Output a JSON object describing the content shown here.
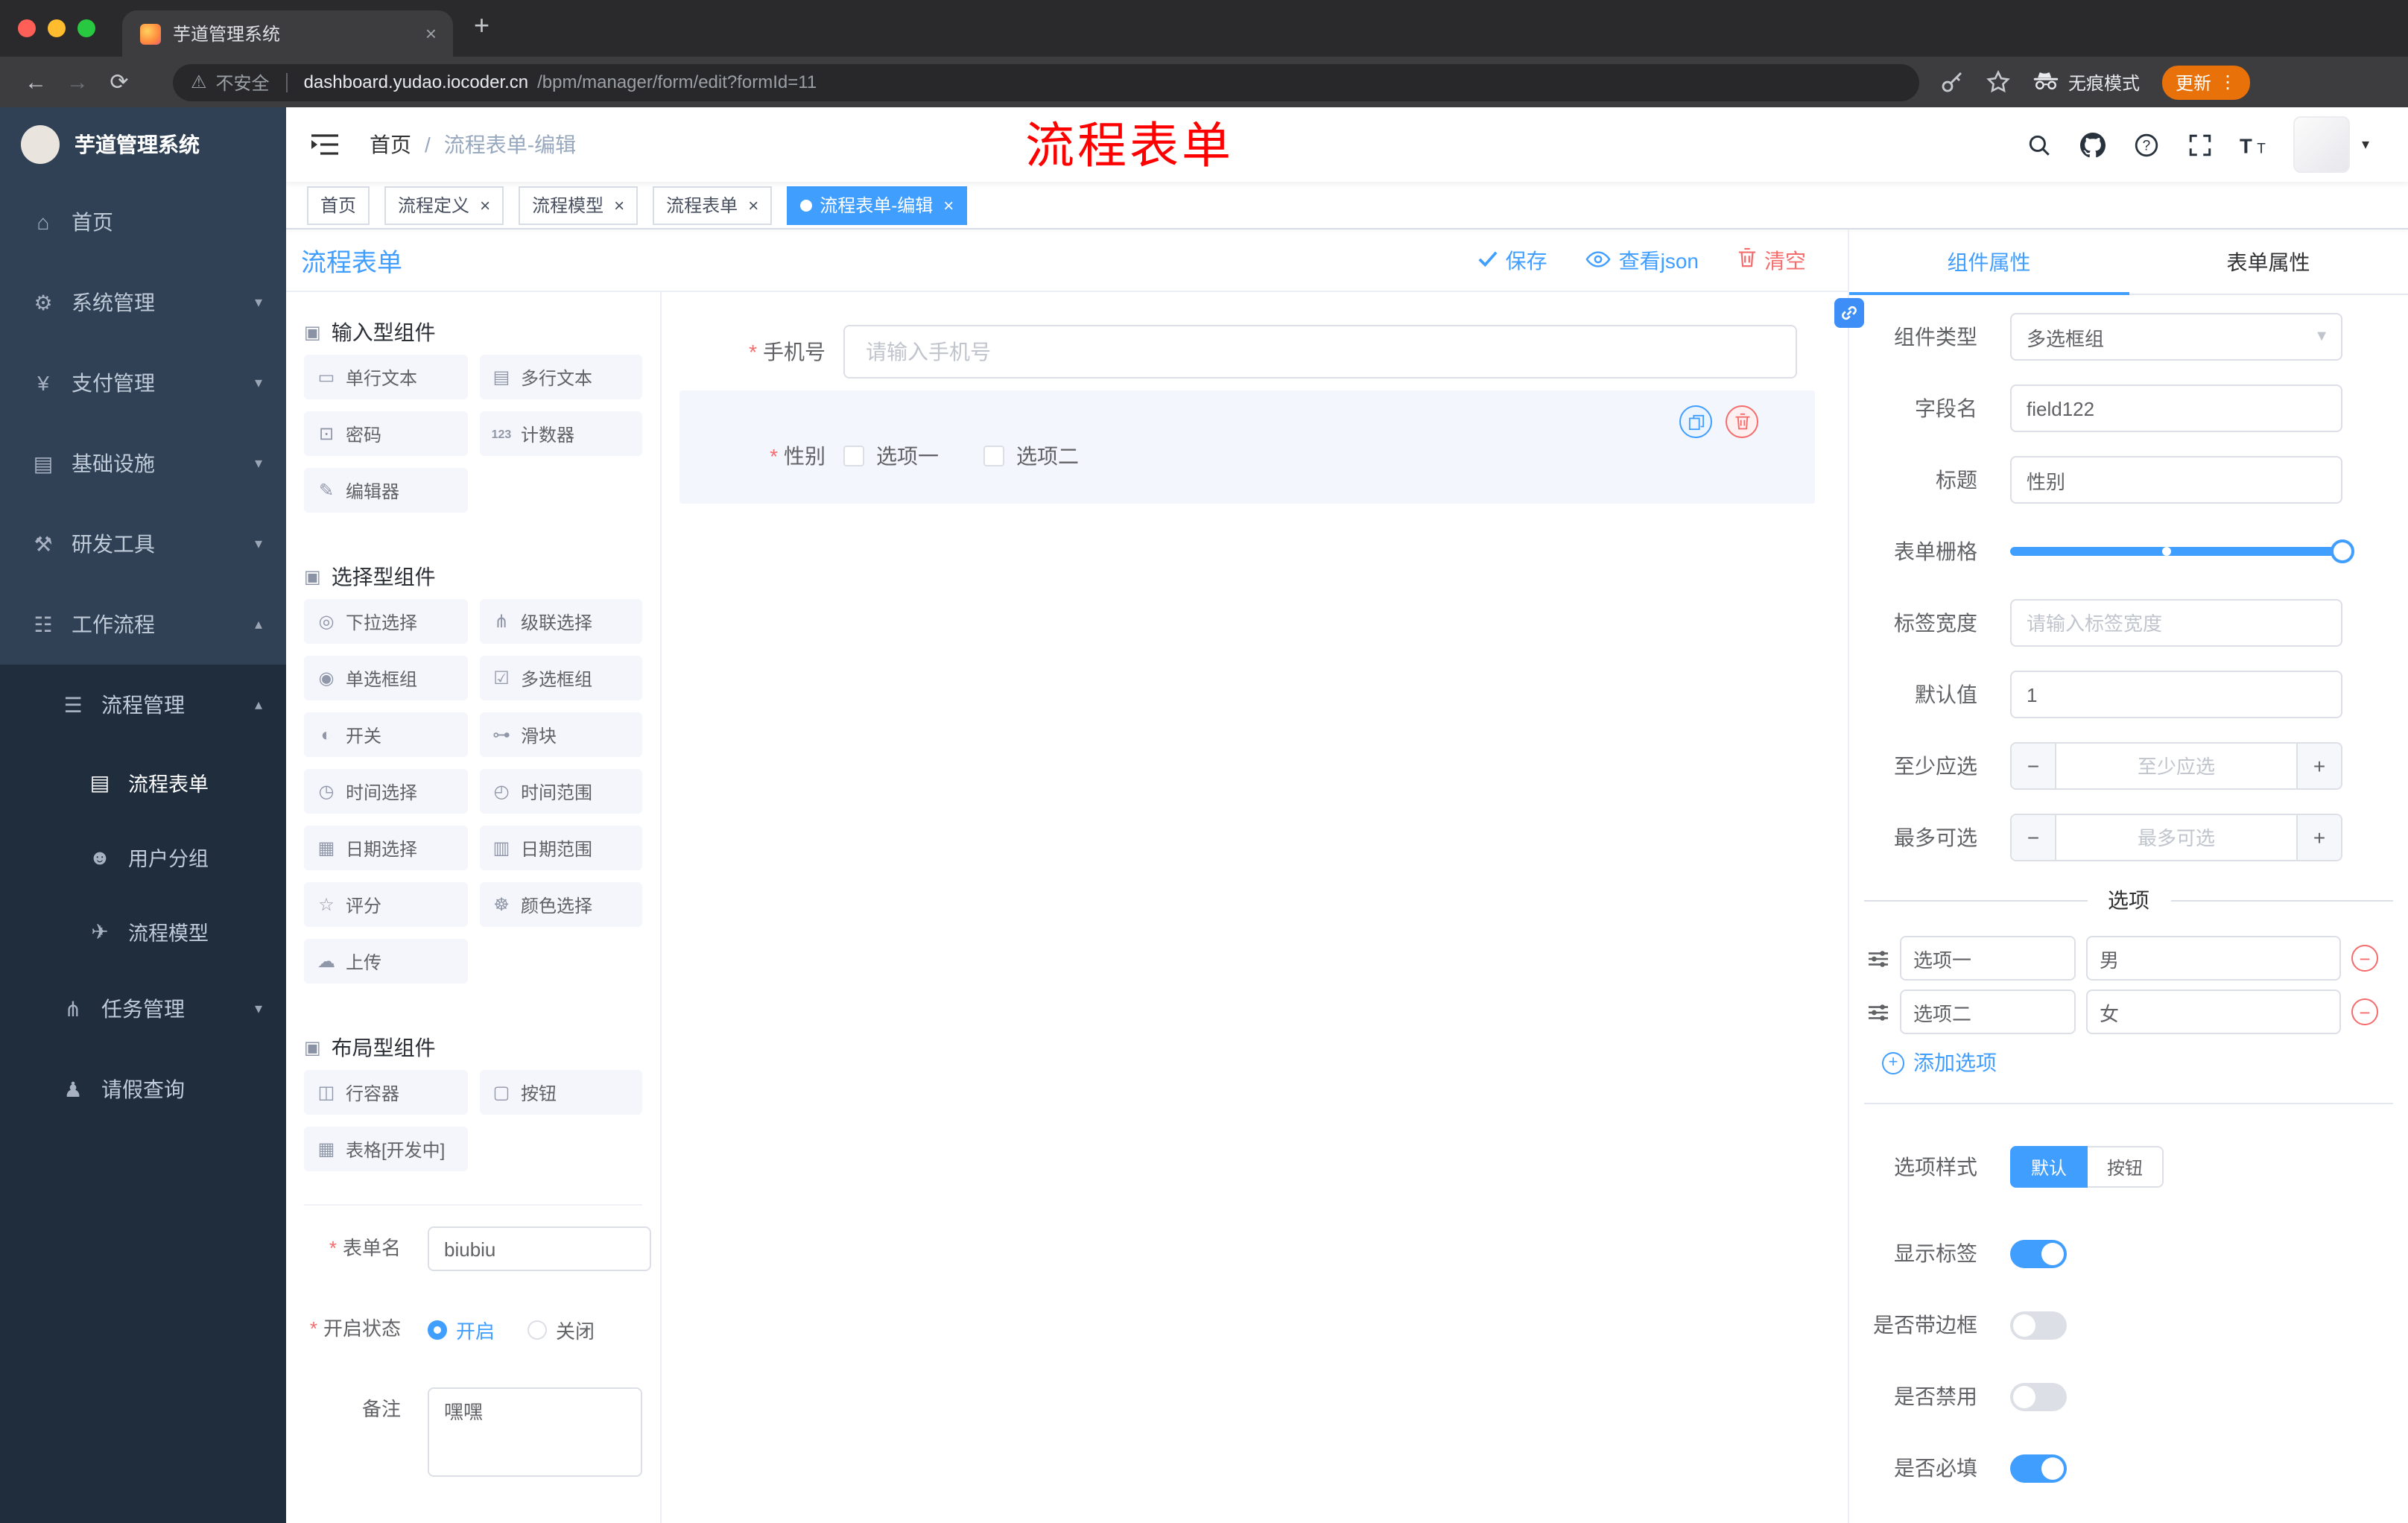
{
  "colors": {
    "accent": "#409eff",
    "danger": "#f56c6c",
    "annotation_red": "#ff0000",
    "sidebar_bg": "#304156",
    "sidebar_sub_bg": "#1f2d3d",
    "update_pill": "#e8710a"
  },
  "browser": {
    "tab_title": "芋道管理系统",
    "security_label": "不安全",
    "url_host": "dashboard.yudao.iocoder.cn",
    "url_path": "/bpm/manager/form/edit?formId=11",
    "incognito_label": "无痕模式",
    "update_label": "更新"
  },
  "annotation": {
    "title": "流程表单"
  },
  "app": {
    "logo_title": "芋道管理系统",
    "breadcrumb": {
      "root": "首页",
      "separator": "/",
      "current": "流程表单-编辑"
    }
  },
  "sidebar": {
    "items": [
      {
        "key": "home",
        "label": "首页",
        "icon": "⌂",
        "level": 0,
        "expandable": false,
        "expanded": false,
        "active": false
      },
      {
        "key": "system",
        "label": "系统管理",
        "icon": "⚙",
        "level": 0,
        "expandable": true,
        "expanded": false,
        "active": false
      },
      {
        "key": "payment",
        "label": "支付管理",
        "icon": "¥",
        "level": 0,
        "expandable": true,
        "expanded": false,
        "active": false
      },
      {
        "key": "infra",
        "label": "基础设施",
        "icon": "▤",
        "level": 0,
        "expandable": true,
        "expanded": false,
        "active": false
      },
      {
        "key": "devtools",
        "label": "研发工具",
        "icon": "⚒",
        "level": 0,
        "expandable": true,
        "expanded": false,
        "active": false
      },
      {
        "key": "workflow",
        "label": "工作流程",
        "icon": "☷",
        "level": 0,
        "expandable": true,
        "expanded": true,
        "active": false
      },
      {
        "key": "process-mgmt",
        "label": "流程管理",
        "icon": "☰",
        "level": 1,
        "expandable": true,
        "expanded": true,
        "active": false
      },
      {
        "key": "process-form",
        "label": "流程表单",
        "icon": "▤",
        "level": 2,
        "expandable": false,
        "expanded": false,
        "active": true
      },
      {
        "key": "user-group",
        "label": "用户分组",
        "icon": "☻",
        "level": 2,
        "expandable": false,
        "expanded": false,
        "active": false
      },
      {
        "key": "process-model",
        "label": "流程模型",
        "icon": "✈",
        "level": 2,
        "expandable": false,
        "expanded": false,
        "active": false
      },
      {
        "key": "task-mgmt",
        "label": "任务管理",
        "icon": "⋔",
        "level": 1,
        "expandable": true,
        "expanded": false,
        "active": false
      },
      {
        "key": "leave-query",
        "label": "请假查询",
        "icon": "♟",
        "level": 1,
        "expandable": false,
        "expanded": false,
        "active": false
      }
    ]
  },
  "tags": [
    {
      "key": "home",
      "label": "首页",
      "closable": false,
      "active": false
    },
    {
      "key": "process-def",
      "label": "流程定义",
      "closable": true,
      "active": false
    },
    {
      "key": "process-model",
      "label": "流程模型",
      "closable": true,
      "active": false
    },
    {
      "key": "process-form",
      "label": "流程表单",
      "closable": true,
      "active": false
    },
    {
      "key": "process-form-edit",
      "label": "流程表单-编辑",
      "closable": true,
      "active": true
    }
  ],
  "palette": {
    "title": "流程表单",
    "groups": [
      {
        "key": "input",
        "title": "输入型组件",
        "icon": "▣",
        "items": [
          {
            "key": "single-text",
            "label": "单行文本",
            "icon": "▭"
          },
          {
            "key": "multi-text",
            "label": "多行文本",
            "icon": "▤"
          },
          {
            "key": "password",
            "label": "密码",
            "icon": "⊡"
          },
          {
            "key": "counter",
            "label": "计数器",
            "icon": "123"
          },
          {
            "key": "editor",
            "label": "编辑器",
            "icon": "✎"
          }
        ]
      },
      {
        "key": "select",
        "title": "选择型组件",
        "icon": "▣",
        "items": [
          {
            "key": "select",
            "label": "下拉选择",
            "icon": "◎"
          },
          {
            "key": "cascader",
            "label": "级联选择",
            "icon": "⋔"
          },
          {
            "key": "radio-group",
            "label": "单选框组",
            "icon": "◉"
          },
          {
            "key": "checkbox-group",
            "label": "多选框组",
            "icon": "☑"
          },
          {
            "key": "switch",
            "label": "开关",
            "icon": "◐"
          },
          {
            "key": "slider",
            "label": "滑块",
            "icon": "⊶"
          },
          {
            "key": "time-picker",
            "label": "时间选择",
            "icon": "◷"
          },
          {
            "key": "time-range",
            "label": "时间范围",
            "icon": "◴"
          },
          {
            "key": "date-picker",
            "label": "日期选择",
            "icon": "▦"
          },
          {
            "key": "date-range",
            "label": "日期范围",
            "icon": "▥"
          },
          {
            "key": "rate",
            "label": "评分",
            "icon": "☆"
          },
          {
            "key": "color-picker",
            "label": "颜色选择",
            "icon": "☸"
          },
          {
            "key": "upload",
            "label": "上传",
            "icon": "☁"
          }
        ]
      },
      {
        "key": "layout",
        "title": "布局型组件",
        "icon": "▣",
        "items": [
          {
            "key": "row-container",
            "label": "行容器",
            "icon": "◫"
          },
          {
            "key": "button",
            "label": "按钮",
            "icon": "▢"
          },
          {
            "key": "table",
            "label": "表格[开发中]",
            "icon": "▦"
          }
        ]
      }
    ],
    "form": {
      "name_label": "表单名",
      "name_value": "biubiu",
      "status_label": "开启状态",
      "status_options": [
        {
          "label": "开启",
          "selected": true
        },
        {
          "label": "关闭",
          "selected": false
        }
      ],
      "remark_label": "备注",
      "remark_value": "嘿嘿"
    }
  },
  "canvas": {
    "toolbar": {
      "save": "保存",
      "view_json": "查看json",
      "clear": "清空"
    },
    "phone": {
      "label": "手机号",
      "placeholder": "请输入手机号"
    },
    "gender": {
      "label": "性别",
      "options": [
        "选项一",
        "选项二"
      ]
    }
  },
  "props": {
    "tabs": [
      {
        "label": "组件属性",
        "active": true
      },
      {
        "label": "表单属性",
        "active": false
      }
    ],
    "component_type": {
      "label": "组件类型",
      "value": "多选框组"
    },
    "field_name": {
      "label": "字段名",
      "value": "field122"
    },
    "title": {
      "label": "标题",
      "value": "性别"
    },
    "grid": {
      "label": "表单栅格"
    },
    "label_width": {
      "label": "标签宽度",
      "placeholder": "请输入标签宽度"
    },
    "default_value": {
      "label": "默认值",
      "value": "1"
    },
    "min_select": {
      "label": "至少应选",
      "placeholder": "至少应选"
    },
    "max_select": {
      "label": "最多可选",
      "placeholder": "最多可选"
    },
    "options_divider": "选项",
    "options": [
      {
        "name": "选项一",
        "value": "男"
      },
      {
        "name": "选项二",
        "value": "女"
      }
    ],
    "add_option": "添加选项",
    "option_style": {
      "label": "选项样式",
      "choices": [
        {
          "label": "默认",
          "active": true
        },
        {
          "label": "按钮",
          "active": false
        }
      ]
    },
    "switches": [
      {
        "key": "show-label",
        "label": "显示标签",
        "on": true
      },
      {
        "key": "border",
        "label": "是否带边框",
        "on": false
      },
      {
        "key": "disabled",
        "label": "是否禁用",
        "on": false
      },
      {
        "key": "required",
        "label": "是否必填",
        "on": true
      }
    ]
  }
}
